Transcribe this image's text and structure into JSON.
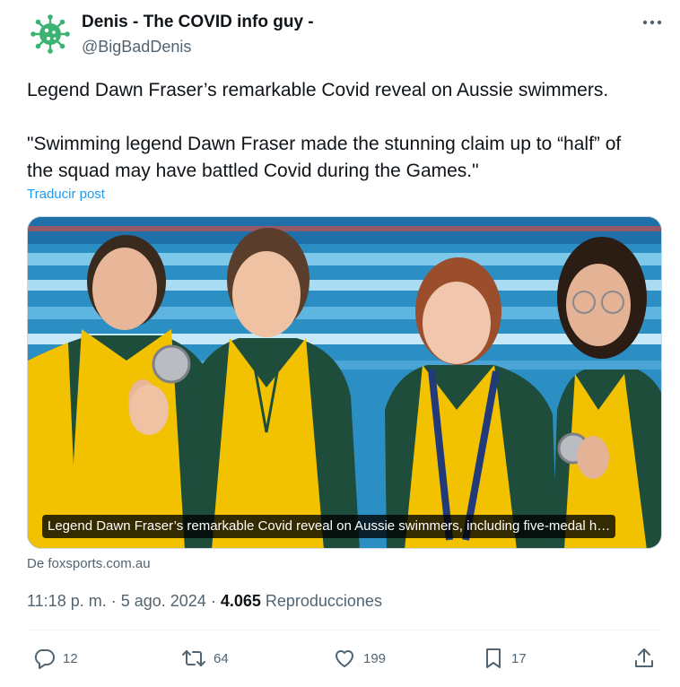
{
  "author": {
    "name": "Denis - The COVID info guy -",
    "handle": "@BigBadDenis",
    "avatar_icon": "virus-icon",
    "avatar_color": "#3cb371"
  },
  "tweet": {
    "line1": "Legend Dawn Fraser’s remarkable Covid reveal on Aussie swimmers.",
    "line2": "\"Swimming legend Dawn Fraser made the stunning claim up to “half” of",
    "line3": "the squad may have battled Covid during the Games.\"",
    "translate_label": "Traducir post"
  },
  "card": {
    "caption": "Legend Dawn Fraser’s remarkable Covid reveal on Aussie swimmers, including five-medal h…",
    "source": "De foxsports.com.au"
  },
  "meta": {
    "time": "11:18 p. m.",
    "separator": " · ",
    "date": "5 ago. 2024",
    "views_count": "4.065",
    "views_label": " Reproducciones"
  },
  "actions": {
    "replies": "12",
    "reposts": "64",
    "likes": "199",
    "bookmarks": "17"
  },
  "colors": {
    "link": "#1d9bf0",
    "secondary_text": "#536471",
    "jacket_yellow": "#f2c200",
    "jacket_green": "#1e4d3c",
    "pool_blue": "#2b8fc4"
  }
}
